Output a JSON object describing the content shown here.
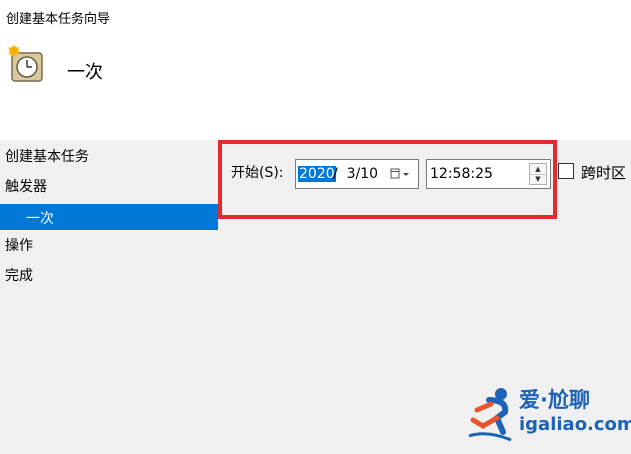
{
  "window": {
    "title": "创建基本任务向导"
  },
  "page": {
    "heading": "一次",
    "icon": "task-clock-icon"
  },
  "nav": {
    "items": [
      {
        "label": "创建基本任务"
      },
      {
        "label": "触发器"
      },
      {
        "label": "一次",
        "selected": true
      },
      {
        "label": "操作"
      },
      {
        "label": "完成"
      }
    ]
  },
  "start": {
    "label": "开始(S):",
    "date_year": "2020",
    "date_rest": "/  3/10",
    "time": "12:58:25"
  },
  "timezone": {
    "label": "跨时区",
    "checked": false
  },
  "watermark": {
    "line1": "爱·尬聊",
    "line2": "igaliao.com"
  },
  "colors": {
    "accent": "#0078d7",
    "highlight_border": "#e52a2f",
    "watermark": "#1c63b7"
  }
}
